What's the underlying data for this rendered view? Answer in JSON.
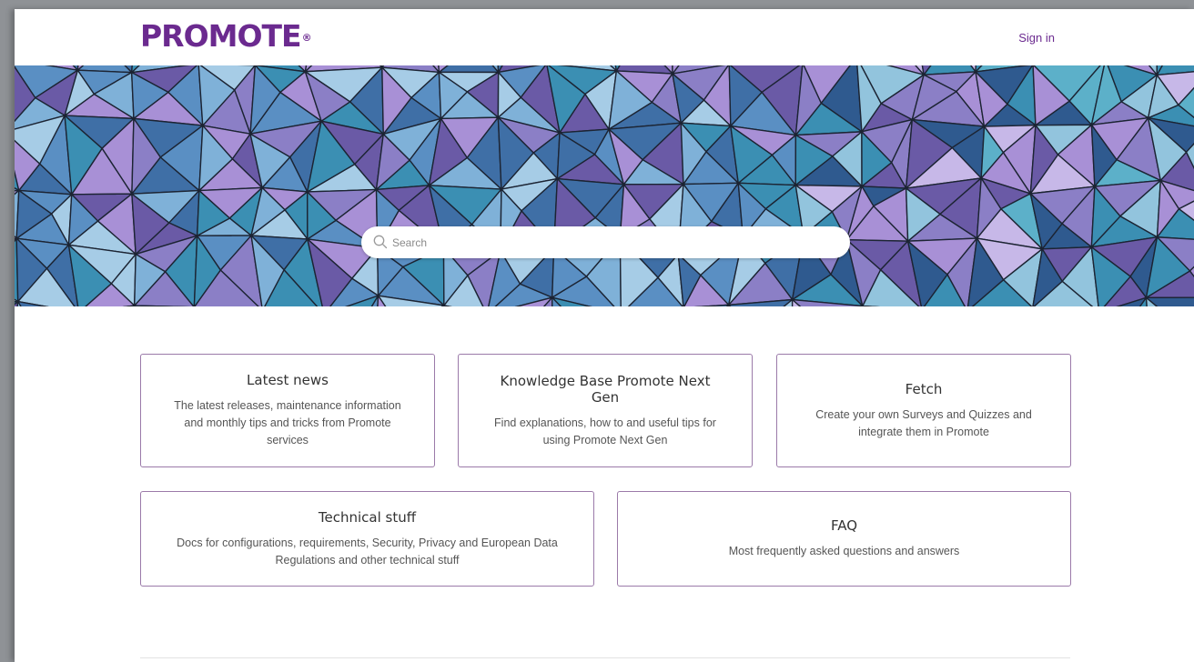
{
  "header": {
    "logo_text": "PROMOTE",
    "logo_mark": "®",
    "signin_label": "Sign in"
  },
  "search": {
    "placeholder": "Search",
    "icon": "search-icon"
  },
  "cards": [
    {
      "title": "Latest news",
      "description": "The latest releases, maintenance information and monthly tips and tricks from Promote services"
    },
    {
      "title": "Knowledge Base Promote Next Gen",
      "description": "Find explanations, how to and useful tips for using Promote Next Gen"
    },
    {
      "title": "Fetch",
      "description": "Create your own Surveys and Quizzes and integrate them in Promote"
    },
    {
      "title": "Technical stuff",
      "description": "Docs for configurations, requirements, Security, Privacy and European Data Regulations and other technical stuff"
    },
    {
      "title": "FAQ",
      "description": "Most frequently asked questions and answers"
    }
  ],
  "colors": {
    "brand": "#6b2a8f",
    "card_border": "#9b7aa9",
    "text_dark": "#333333",
    "text_muted": "#555555"
  }
}
